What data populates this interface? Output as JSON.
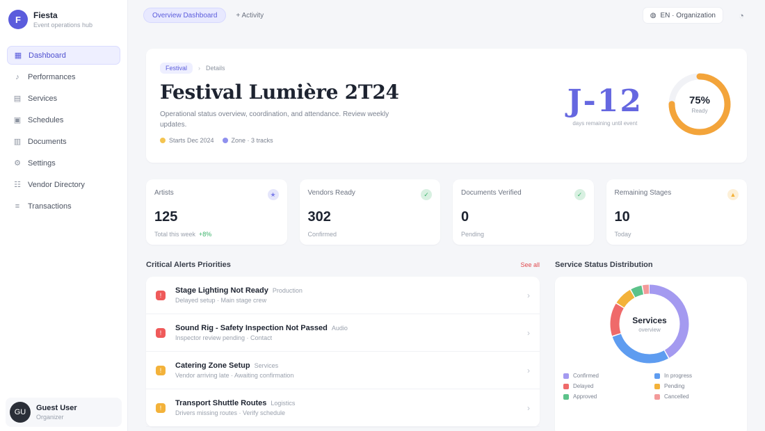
{
  "brand": {
    "name": "Fiesta",
    "subtitle": "Event operations hub",
    "initial": "F"
  },
  "nav": [
    {
      "label": "Dashboard",
      "icon": "grid-icon",
      "glyph": "▦",
      "active": true
    },
    {
      "label": "Performances",
      "icon": "music-icon",
      "glyph": "♪",
      "active": false
    },
    {
      "label": "Services",
      "icon": "briefcase-icon",
      "glyph": "▤",
      "active": false
    },
    {
      "label": "Schedules",
      "icon": "calendar-icon",
      "glyph": "▣",
      "active": false
    },
    {
      "label": "Documents",
      "icon": "document-icon",
      "glyph": "▥",
      "active": false
    },
    {
      "label": "Settings",
      "icon": "gear-icon",
      "glyph": "⚙",
      "active": false
    },
    {
      "label": "Vendor Directory",
      "icon": "users-icon",
      "glyph": "☷",
      "active": false
    },
    {
      "label": "Transactions",
      "icon": "receipt-icon",
      "glyph": "≡",
      "active": false
    }
  ],
  "user": {
    "name": "Guest User",
    "role": "Organizer",
    "initials": "GU"
  },
  "topbar": {
    "primary_pill": "Overview Dashboard",
    "link": "+ Activity",
    "language": "EN · Organization"
  },
  "hero": {
    "tag": "Festival",
    "crumb": "Details",
    "title": "Festival Lumière 2T24",
    "description": "Operational status overview, coordination, and attendance. Review weekly updates.",
    "chips": [
      {
        "label": "Starts Dec 2024",
        "color": "#f4c451"
      },
      {
        "label": "Zone · 3 tracks",
        "color": "#8f90ee"
      }
    ],
    "big_stat": "J-12",
    "big_stat_caption": "days remaining until event",
    "ring_value": "75%",
    "ring_label": "Ready",
    "ring_percent": 0.75,
    "ring_color": "#f3a43a"
  },
  "kpis": [
    {
      "label": "Artists",
      "value": "125",
      "sub": "Total this week",
      "delta": "+8%",
      "icon_color": "#7f80ea",
      "icon": "star-icon",
      "glyph": "★"
    },
    {
      "label": "Vendors Ready",
      "value": "302",
      "sub": "Confirmed",
      "delta": "",
      "icon_color": "#3bb36a",
      "icon": "check-icon",
      "glyph": "✓"
    },
    {
      "label": "Documents Verified",
      "value": "0",
      "sub": "Pending",
      "delta": "",
      "icon_color": "#3bb36a",
      "icon": "shield-icon",
      "glyph": "✓"
    },
    {
      "label": "Remaining Stages",
      "value": "10",
      "sub": "Today",
      "delta": "",
      "icon_color": "#f3b23a",
      "icon": "flag-icon",
      "glyph": "▲"
    }
  ],
  "alerts_section": {
    "title": "Critical Alerts Priorities",
    "link": "See all"
  },
  "alerts": [
    {
      "title": "Stage Lighting Not Ready",
      "tag": "Production",
      "sub": "Delayed setup · Main stage crew",
      "color": "#ef5a5a"
    },
    {
      "title": "Sound Rig - Safety Inspection Not Passed",
      "tag": "Audio",
      "sub": "Inspector review pending · Contact",
      "color": "#ef5a5a"
    },
    {
      "title": "Catering Zone Setup",
      "tag": "Services",
      "sub": "Vendor arriving late · Awaiting confirmation",
      "color": "#f3b23a"
    },
    {
      "title": "Transport Shuttle Routes",
      "tag": "Logistics",
      "sub": "Drivers missing routes · Verify schedule",
      "color": "#f3b23a"
    }
  ],
  "distribution": {
    "title": "Service Status Distribution",
    "center_value": "Services",
    "center_label": "overview",
    "segments": [
      {
        "label": "Confirmed",
        "share": 0.42,
        "color": "#a49af0"
      },
      {
        "label": "In progress",
        "share": 0.28,
        "color": "#5e9cf0"
      },
      {
        "label": "Delayed",
        "share": 0.14,
        "color": "#ef6a6a"
      },
      {
        "label": "Pending",
        "share": 0.08,
        "color": "#f3b23a"
      },
      {
        "label": "Approved",
        "share": 0.05,
        "color": "#5cc28a"
      },
      {
        "label": "Cancelled",
        "share": 0.03,
        "color": "#f39a9a"
      }
    ]
  }
}
